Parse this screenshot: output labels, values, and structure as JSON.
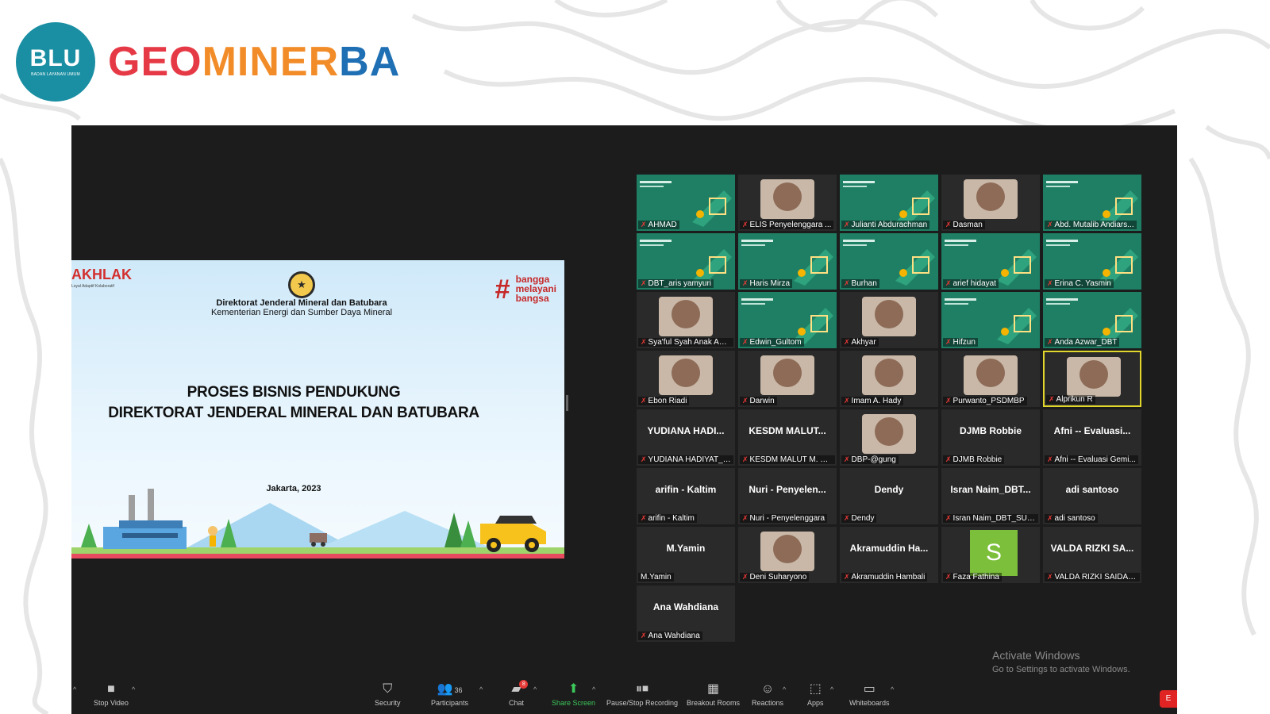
{
  "header": {
    "logo_text": "BLU",
    "logo_subtext": "BADAN LAYANAN UMUM",
    "brand_part1": "GEO",
    "brand_part2": "MINER",
    "brand_part3": "BA",
    "colors": {
      "blu": "#1a8fa3",
      "geo": "#e63946",
      "miner": "#f28c28",
      "ba": "#1f6fb4"
    }
  },
  "slide": {
    "akhlak": "AKHLAK",
    "akhlak_sub": "Loyal Adaptif Kolaboratif",
    "org_line1": "Direktorat Jenderal Mineral dan Batubara",
    "org_line2": "Kementerian Energi dan Sumber Daya Mineral",
    "tagline": [
      "bangga",
      "melayani",
      "bangsa"
    ],
    "title_line1": "PROSES BISNIS PENDUKUNG",
    "title_line2": "DIREKTORAT JENDERAL MINERAL DAN BATUBARA",
    "date_text": "Jakarta,  2023"
  },
  "participants": [
    {
      "name": "AHMAD",
      "type": "slide"
    },
    {
      "name": "ELIS Penyelenggara ...",
      "type": "cam"
    },
    {
      "name": "Julianti Abdurachman",
      "type": "slide"
    },
    {
      "name": "Dasman",
      "type": "cam"
    },
    {
      "name": "Abd. Mutalib Andiars...",
      "type": "slide"
    },
    {
      "name": "DBT_aris yamyuri",
      "type": "slide"
    },
    {
      "name": "Haris Mirza",
      "type": "slide"
    },
    {
      "name": "Burhan",
      "type": "slide"
    },
    {
      "name": "arief hidayat",
      "type": "slide"
    },
    {
      "name": "Erina C. Yasmin",
      "type": "slide"
    },
    {
      "name": "Sya'ful Syah Anak Am...",
      "type": "cam"
    },
    {
      "name": "Edwin_Gultom",
      "type": "slide"
    },
    {
      "name": "Akhyar",
      "type": "cam"
    },
    {
      "name": "Hifzun",
      "type": "slide"
    },
    {
      "name": "Anda Azwar_DBT",
      "type": "slide"
    },
    {
      "name": "Ebon Riadi",
      "type": "cam"
    },
    {
      "name": "Darwin",
      "type": "cam"
    },
    {
      "name": "Imam A. Hady",
      "type": "cam"
    },
    {
      "name": "Purwanto_PSDMBP",
      "type": "cam"
    },
    {
      "name": "Alprikun R",
      "type": "active"
    },
    {
      "display": "YUDIANA HADI...",
      "name": "YUDIANA HADIYAT_PP...",
      "type": "name"
    },
    {
      "display": "KESDM MALUT...",
      "name": "KESDM MALUT M. RI...",
      "type": "name"
    },
    {
      "name": "DBP-@gung",
      "type": "cam"
    },
    {
      "display": "DJMB Robbie",
      "name": "DJMB Robbie",
      "type": "name"
    },
    {
      "display": "Afni -- Evaluasi...",
      "name": "Afni -- Evaluasi Gemi...",
      "type": "name"
    },
    {
      "display": "arifin - Kaltim",
      "name": "arifin - Kaltim",
      "type": "name"
    },
    {
      "display": "Nuri - Penyelen...",
      "name": "Nuri - Penyelenggara",
      "type": "name"
    },
    {
      "display": "Dendy",
      "name": "Dendy",
      "type": "name"
    },
    {
      "display": "Isran Naim_DBT...",
      "name": "Isran Naim_DBT_SULT...",
      "type": "name"
    },
    {
      "display": "adi santoso",
      "name": "adi santoso",
      "type": "name"
    },
    {
      "display": "M.Yamin",
      "name": "M.Yamin",
      "type": "name",
      "unmuted": true
    },
    {
      "name": "Deni Suharyono",
      "type": "cam"
    },
    {
      "display": "Akramuddin Ha...",
      "name": "Akramuddin Hambali",
      "type": "name"
    },
    {
      "letter": "S",
      "name": "Faza Fathina",
      "type": "letter"
    },
    {
      "display": "VALDA RIZKI SA...",
      "name": "VALDA RIZKI SAIDAH ...",
      "type": "name"
    },
    {
      "display": "Ana Wahdiana",
      "name": "Ana Wahdiana",
      "type": "name"
    }
  ],
  "activate_windows": {
    "title": "Activate Windows",
    "subtitle": "Go to Settings to activate Windows."
  },
  "toolbar": {
    "stop_video": "Stop Video",
    "security": "Security",
    "participants": "Participants",
    "participants_count": "36",
    "chat": "Chat",
    "chat_badge": "8",
    "share_screen": "Share Screen",
    "recording": "Pause/Stop Recording",
    "breakout": "Breakout Rooms",
    "reactions": "Reactions",
    "apps": "Apps",
    "whiteboards": "Whiteboards",
    "end": "E"
  }
}
